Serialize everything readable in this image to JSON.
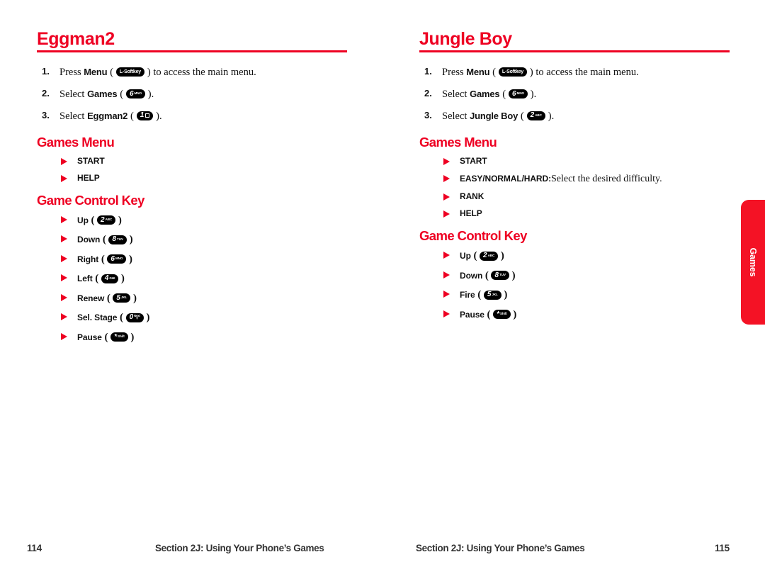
{
  "side_tab": {
    "label": "Games"
  },
  "colors": {
    "accent_red": "#ee0022",
    "tab_red": "#f41225",
    "text_black": "#111111",
    "footer_gray": "#333333"
  },
  "left_page": {
    "title": "Eggman2",
    "steps": [
      {
        "num": "1.",
        "pre": "Press ",
        "keyword": "Menu",
        "key": {
          "type": "softkey",
          "main": "L-Softkey"
        },
        "post": " to access the main menu."
      },
      {
        "num": "2.",
        "pre": "Select ",
        "keyword": "Games",
        "key": {
          "type": "digit",
          "main": "6",
          "sub": "MNO"
        },
        "post": "."
      },
      {
        "num": "3.",
        "pre": "Select ",
        "keyword": "Eggman2",
        "key": {
          "type": "icon",
          "main": "1",
          "sub": ""
        },
        "post": "."
      }
    ],
    "sections": [
      {
        "heading": "Games Menu",
        "items": [
          {
            "label": "START",
            "key": null,
            "desc": ""
          },
          {
            "label": "HELP",
            "key": null,
            "desc": ""
          }
        ]
      },
      {
        "heading": "Game Control Key",
        "items": [
          {
            "label": "Up",
            "key": {
              "type": "digit",
              "main": "2",
              "sub": "ABC"
            },
            "desc": ""
          },
          {
            "label": "Down",
            "key": {
              "type": "digit",
              "main": "8",
              "sub": "TUV"
            },
            "desc": ""
          },
          {
            "label": "Right",
            "key": {
              "type": "digit",
              "main": "6",
              "sub": "MNO"
            },
            "desc": ""
          },
          {
            "label": "Left",
            "key": {
              "type": "digit",
              "main": "4",
              "sub": "GHI"
            },
            "desc": ""
          },
          {
            "label": "Renew",
            "key": {
              "type": "digit",
              "main": "5",
              "sub": "JKL"
            },
            "desc": ""
          },
          {
            "label": "Sel. Stage",
            "key": {
              "type": "stacked",
              "main": "0",
              "sub_top": "Next",
              "sub_bottom": "+"
            },
            "desc": ""
          },
          {
            "label": "Pause",
            "key": {
              "type": "digit",
              "main": "*",
              "sub": "Shift"
            },
            "desc": ""
          }
        ]
      }
    ],
    "footer": {
      "page_number": "114",
      "section_text": "Section 2J: Using Your Phone’s Games"
    }
  },
  "right_page": {
    "title": "Jungle Boy",
    "steps": [
      {
        "num": "1.",
        "pre": "Press ",
        "keyword": "Menu",
        "key": {
          "type": "softkey",
          "main": "L-Softkey"
        },
        "post": " to access the main menu."
      },
      {
        "num": "2.",
        "pre": "Select ",
        "keyword": "Games",
        "key": {
          "type": "digit",
          "main": "6",
          "sub": "MNO"
        },
        "post": "."
      },
      {
        "num": "3.",
        "pre": "Select ",
        "keyword": "Jungle Boy",
        "key": {
          "type": "digit",
          "main": "2",
          "sub": "ABC"
        },
        "post": "."
      }
    ],
    "sections": [
      {
        "heading": "Games Menu",
        "items": [
          {
            "label": "START",
            "key": null,
            "desc": ""
          },
          {
            "label": "EASY/NORMAL/HARD:",
            "key": null,
            "desc": "Select the desired difficulty."
          },
          {
            "label": "RANK",
            "key": null,
            "desc": ""
          },
          {
            "label": "HELP",
            "key": null,
            "desc": ""
          }
        ]
      },
      {
        "heading": "Game Control Key",
        "items": [
          {
            "label": "Up",
            "key": {
              "type": "digit",
              "main": "2",
              "sub": "ABC"
            },
            "desc": ""
          },
          {
            "label": "Down",
            "key": {
              "type": "digit",
              "main": "8",
              "sub": "TUV"
            },
            "desc": ""
          },
          {
            "label": "Fire",
            "key": {
              "type": "digit",
              "main": "5",
              "sub": "JKL"
            },
            "desc": ""
          },
          {
            "label": "Pause",
            "key": {
              "type": "digit",
              "main": "*",
              "sub": "Shift"
            },
            "desc": ""
          }
        ]
      }
    ],
    "footer": {
      "page_number": "115",
      "section_text": "Section 2J: Using Your Phone’s Games"
    }
  }
}
